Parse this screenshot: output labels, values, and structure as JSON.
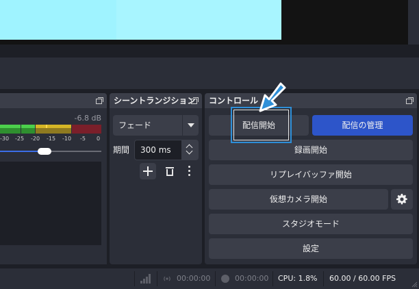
{
  "audio_mixer": {
    "db_value": "-6.8 dB",
    "ticks": [
      "-30",
      "-25",
      "-20",
      "-15",
      "-10",
      "-5",
      "0"
    ]
  },
  "transitions": {
    "title": "シーントランジション",
    "selected": "フェード",
    "duration_label": "期間",
    "duration_value": "300 ms"
  },
  "controls": {
    "title": "コントロール",
    "start_stream": "配信開始",
    "manage_stream": "配信の管理",
    "start_recording": "録画開始",
    "start_replay_buffer": "リプレイバッファ開始",
    "start_virtual_camera": "仮想カメラ開始",
    "studio_mode": "スタジオモード",
    "settings": "設定"
  },
  "status_bar": {
    "stream_time": "00:00:00",
    "record_time": "00:00:00",
    "cpu": "CPU: 1.8%",
    "fps": "60.00 / 60.00 FPS"
  },
  "colors": {
    "background": "#1d1f26",
    "panel": "#2b2e38",
    "button": "#3b3e49",
    "accent_blue": "#2d55c9",
    "highlight_blue": "#2e8fd8",
    "preview_cyan": "#9ff3ff"
  },
  "icons": {
    "float": "float-icon",
    "add": "plus-icon",
    "remove": "trash-icon",
    "more": "kebab-menu-icon",
    "gear": "gear-icon",
    "signal": "signal-strength-icon",
    "stream": "broadcast-icon",
    "record": "record-dot-icon",
    "pointer": "arrow-pointer-icon"
  }
}
